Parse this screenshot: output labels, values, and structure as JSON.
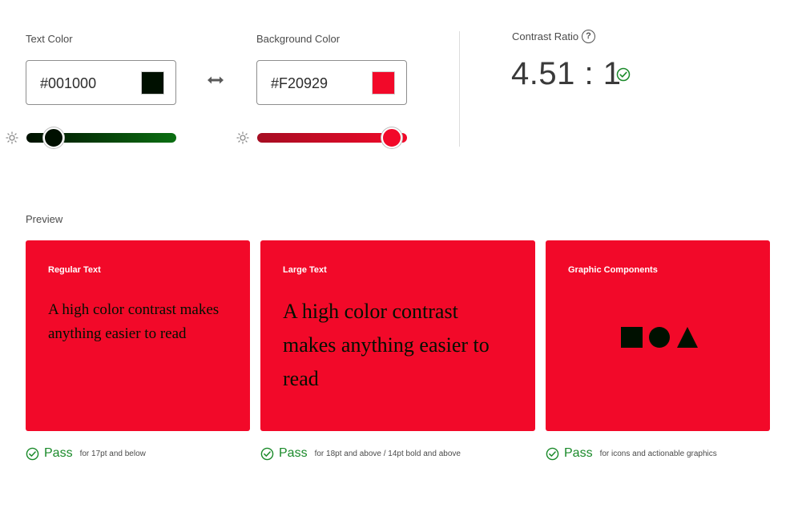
{
  "text_color": {
    "label": "Text Color",
    "value": "#001000",
    "swatch": "#001000",
    "slider_gradient": [
      "#001000",
      "#0b6f12"
    ],
    "slider_level": 0.14
  },
  "swap_icon": "swap-arrows-icon",
  "background_color": {
    "label": "Background Color",
    "value": "#F20929",
    "swatch": "#F20929",
    "slider_gradient": [
      "#a50d22",
      "#f20929"
    ],
    "slider_level": 0.91
  },
  "contrast": {
    "label": "Contrast Ratio",
    "value": "4.51 : 1",
    "help_glyph": "?",
    "status": "pass"
  },
  "preview": {
    "label": "Preview",
    "cards": [
      {
        "title": "Regular Text",
        "text": "A high color contrast makes anything easier to read",
        "result": "Pass",
        "note": "for 17pt and below"
      },
      {
        "title": "Large Text",
        "text": "A high color contrast makes anything easier to read",
        "result": "Pass",
        "note": "for 18pt and above / 14pt bold and above"
      },
      {
        "title": "Graphic Components",
        "shapes": [
          "square",
          "circle",
          "triangle"
        ],
        "result": "Pass",
        "note": "for icons and actionable graphics"
      }
    ]
  },
  "colors": {
    "pass_green": "#1a8a2a",
    "card_bg": "#F20929",
    "foreground": "#001000"
  }
}
